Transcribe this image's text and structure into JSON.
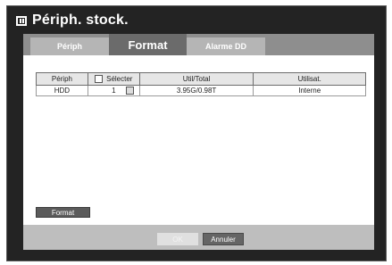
{
  "window": {
    "title": "Périph. stock."
  },
  "tabs": [
    {
      "label": "Périph",
      "active": false
    },
    {
      "label": "Format",
      "active": true
    },
    {
      "label": "Alarme DD",
      "active": false
    }
  ],
  "table": {
    "headers": {
      "device": "Périph",
      "select": "Sélecter",
      "usage": "Util/Total",
      "use": "Utilisat."
    },
    "rows": [
      {
        "device": "HDD",
        "select": "1",
        "usage": "3.95G/0.98T",
        "use": "Interne"
      }
    ]
  },
  "panel": {
    "format_label": "Format"
  },
  "footer": {
    "ok_label": "OK",
    "cancel_label": "Annuler"
  }
}
